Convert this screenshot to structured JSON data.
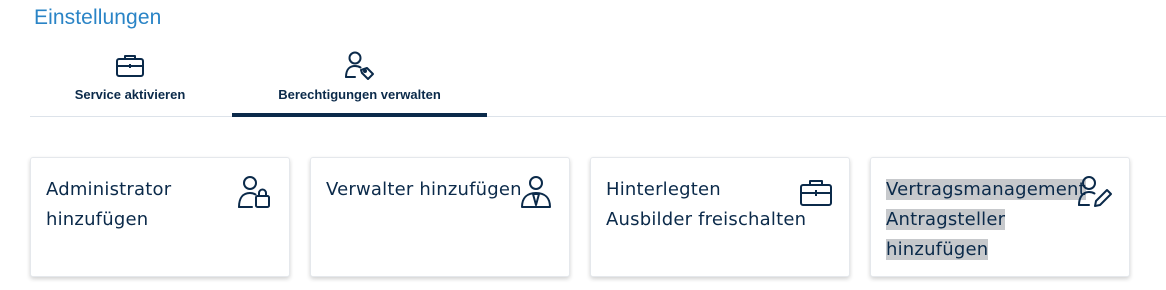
{
  "page": {
    "title": "Einstellungen"
  },
  "tabs": [
    {
      "label": "Service aktivieren",
      "icon": "briefcase-icon",
      "active": false
    },
    {
      "label": "Berechtigungen verwalten",
      "icon": "user-tag-icon",
      "active": true
    }
  ],
  "cards": [
    {
      "lines": [
        "Administrator",
        "hinzufügen"
      ],
      "icon": "user-lock-icon"
    },
    {
      "lines": [
        "Verwalter hinzufügen"
      ],
      "icon": "user-tie-icon"
    },
    {
      "lines": [
        "Hinterlegten",
        "Ausbilder freischalten"
      ],
      "icon": "briefcase-icon"
    },
    {
      "lines": [
        "Vertragsmanagement",
        "Antragsteller",
        "hinzufügen"
      ],
      "icon": "user-edit-icon",
      "highlighted": true
    }
  ],
  "colors": {
    "title": "#2a84c6",
    "text": "#0b2a4a",
    "active_tab_bar": "#0b2a4a",
    "highlight": "#c7c9cc"
  }
}
